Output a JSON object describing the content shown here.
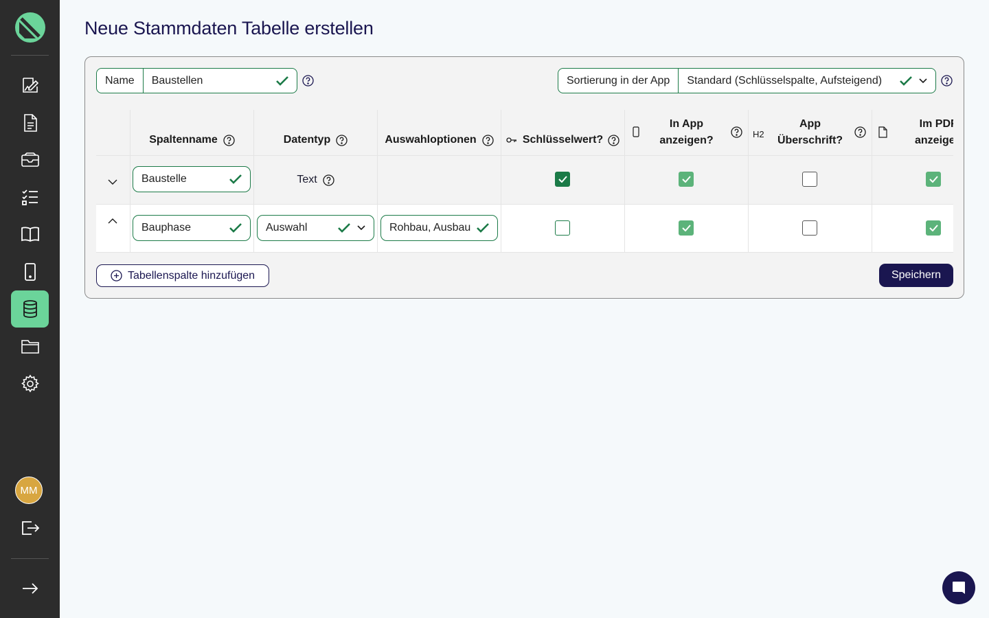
{
  "page": {
    "title": "Neue Stammdaten Tabelle erstellen"
  },
  "sidebar": {
    "items": [
      {
        "icon": "edit-template-icon"
      },
      {
        "icon": "report-icon"
      },
      {
        "icon": "inbox-icon"
      },
      {
        "icon": "checklist-icon"
      },
      {
        "icon": "book-icon"
      },
      {
        "icon": "smartphone-icon"
      },
      {
        "icon": "database-icon",
        "active": true
      },
      {
        "icon": "folder-icon"
      },
      {
        "icon": "gear-icon"
      }
    ],
    "avatar_initials": "MM",
    "accent": "#6bd49a"
  },
  "form": {
    "name_label": "Name",
    "name_value": "Baustellen",
    "sort_label": "Sortierung in der App",
    "sort_value": "Standard (Schlüsselspalte, Aufsteigend)"
  },
  "table": {
    "headers": {
      "spaltenname": "Spaltenname",
      "datentyp": "Datentyp",
      "auswahloptionen": "Auswahloptionen",
      "schluesselwert": "Schlüsselwert?",
      "in_app_1": "In App",
      "in_app_2": "anzeigen?",
      "h2_tag": "H2",
      "ueberschrift_1": "App",
      "ueberschrift_2": "Überschrift?",
      "pdf_1": "Im PDF",
      "pdf_2": "anzeigen"
    },
    "rows": [
      {
        "name": "Baustelle",
        "type": "Text",
        "options": "",
        "key": true,
        "in_app": true,
        "heading": false,
        "pdf": true
      },
      {
        "name": "Bauphase",
        "type": "Auswahl",
        "options": "Rohbau, Ausbau",
        "key": false,
        "in_app": true,
        "heading": false,
        "pdf": true
      }
    ]
  },
  "actions": {
    "add_column": "Tabellenspalte hinzufügen",
    "save": "Speichern"
  },
  "colors": {
    "primary": "#1a1650",
    "success": "#1b7a47",
    "check": "#5cb37a"
  }
}
